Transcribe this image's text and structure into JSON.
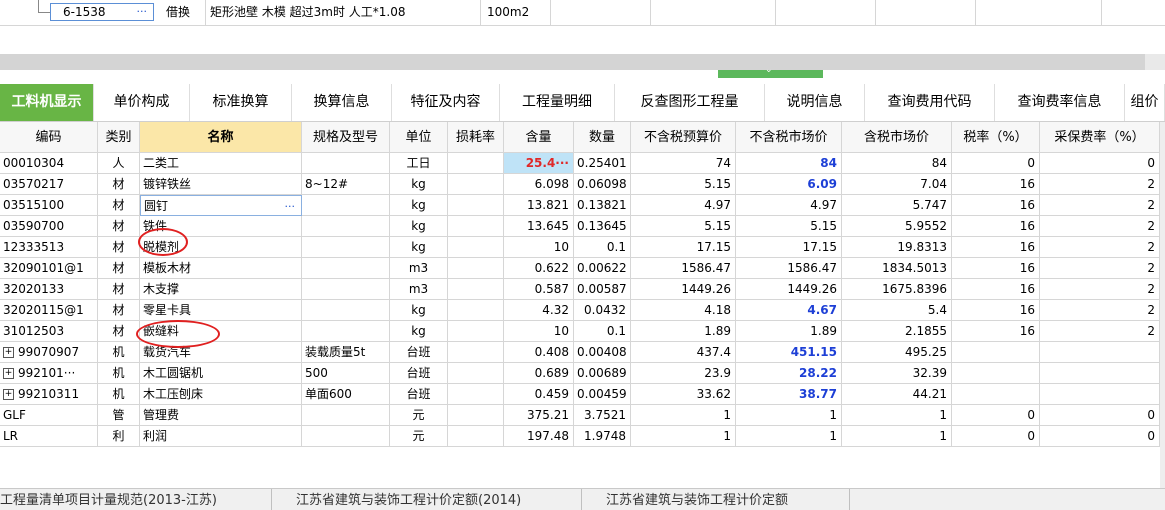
{
  "top_row": {
    "code": "6-1538",
    "type": "借换",
    "name": "矩形池壁 木模  超过3m时 人工*1.08",
    "unit": "100m2"
  },
  "tabs": [
    {
      "label": "工料机显示",
      "active": true
    },
    {
      "label": "单价构成"
    },
    {
      "label": "标准换算"
    },
    {
      "label": "换算信息"
    },
    {
      "label": "特征及内容"
    },
    {
      "label": "工程量明细"
    },
    {
      "label": "反查图形工程量"
    },
    {
      "label": "说明信息"
    },
    {
      "label": "查询费用代码"
    },
    {
      "label": "查询费率信息"
    },
    {
      "label": "组价"
    }
  ],
  "columns": [
    "编码",
    "类别",
    "名称",
    "规格及型号",
    "单位",
    "损耗率",
    "含量",
    "数量",
    "不含税预算价",
    "不含税市场价",
    "含税市场价",
    "税率（%）",
    "采保费率（%）"
  ],
  "rows": [
    {
      "code": "00010304",
      "cat": "人",
      "name": "二类工",
      "spec": "",
      "unit": "工日",
      "loss": "",
      "content": "25.4···",
      "qty": "0.25401",
      "budget": "74",
      "market": "84",
      "taxmarket": "84",
      "tax": "0",
      "fee": "0",
      "content_red": true,
      "market_blue": true
    },
    {
      "code": "03570217",
      "cat": "材",
      "name": "镀锌铁丝",
      "spec": "8~12#",
      "unit": "kg",
      "loss": "",
      "content": "6.098",
      "qty": "0.06098",
      "budget": "5.15",
      "market": "6.09",
      "taxmarket": "7.04",
      "tax": "16",
      "fee": "2",
      "market_blue": true
    },
    {
      "code": "03515100",
      "cat": "材",
      "name": "圆钉",
      "spec": "",
      "unit": "kg",
      "loss": "",
      "content": "13.821",
      "qty": "0.13821",
      "budget": "4.97",
      "market": "4.97",
      "taxmarket": "5.747",
      "tax": "16",
      "fee": "2",
      "editing": true
    },
    {
      "code": "03590700",
      "cat": "材",
      "name": "铁件",
      "spec": "",
      "unit": "kg",
      "loss": "",
      "content": "13.645",
      "qty": "0.13645",
      "budget": "5.15",
      "market": "5.15",
      "taxmarket": "5.9552",
      "tax": "16",
      "fee": "2"
    },
    {
      "code": "12333513",
      "cat": "材",
      "name": "脱模剂",
      "spec": "",
      "unit": "kg",
      "loss": "",
      "content": "10",
      "qty": "0.1",
      "budget": "17.15",
      "market": "17.15",
      "taxmarket": "19.8313",
      "tax": "16",
      "fee": "2"
    },
    {
      "code": "32090101@1",
      "cat": "材",
      "name": "模板木材",
      "spec": "",
      "unit": "m3",
      "loss": "",
      "content": "0.622",
      "qty": "0.00622",
      "budget": "1586.47",
      "market": "1586.47",
      "taxmarket": "1834.5013",
      "tax": "16",
      "fee": "2"
    },
    {
      "code": "32020133",
      "cat": "材",
      "name": "木支撑",
      "spec": "",
      "unit": "m3",
      "loss": "",
      "content": "0.587",
      "qty": "0.00587",
      "budget": "1449.26",
      "market": "1449.26",
      "taxmarket": "1675.8396",
      "tax": "16",
      "fee": "2"
    },
    {
      "code": "32020115@1",
      "cat": "材",
      "name": "零星卡具",
      "spec": "",
      "unit": "kg",
      "loss": "",
      "content": "4.32",
      "qty": "0.0432",
      "budget": "4.18",
      "market": "4.67",
      "taxmarket": "5.4",
      "tax": "16",
      "fee": "2",
      "market_blue": true
    },
    {
      "code": "31012503",
      "cat": "材",
      "name": "嵌缝料",
      "spec": "",
      "unit": "kg",
      "loss": "",
      "content": "10",
      "qty": "0.1",
      "budget": "1.89",
      "market": "1.89",
      "taxmarket": "2.1855",
      "tax": "16",
      "fee": "2"
    },
    {
      "code": "99070907",
      "cat": "机",
      "name": "载货汽车",
      "spec": "装载质量5t",
      "unit": "台班",
      "loss": "",
      "content": "0.408",
      "qty": "0.00408",
      "budget": "437.4",
      "market": "451.15",
      "taxmarket": "495.25",
      "tax": "",
      "fee": "",
      "market_blue": true,
      "expand": "+"
    },
    {
      "code": "992101···",
      "cat": "机",
      "name": "木工圆锯机",
      "spec": "500",
      "unit": "台班",
      "loss": "",
      "content": "0.689",
      "qty": "0.00689",
      "budget": "23.9",
      "market": "28.22",
      "taxmarket": "32.39",
      "tax": "",
      "fee": "",
      "market_blue": true,
      "expand": "+"
    },
    {
      "code": "99210311",
      "cat": "机",
      "name": "木工压刨床",
      "spec": "单面600",
      "unit": "台班",
      "loss": "",
      "content": "0.459",
      "qty": "0.00459",
      "budget": "33.62",
      "market": "38.77",
      "taxmarket": "44.21",
      "tax": "",
      "fee": "",
      "market_blue": true,
      "expand": "+"
    },
    {
      "code": "GLF",
      "cat": "管",
      "name": "管理费",
      "spec": "",
      "unit": "元",
      "loss": "",
      "content": "375.21",
      "qty": "3.7521",
      "budget": "1",
      "market": "1",
      "taxmarket": "1",
      "tax": "0",
      "fee": "0"
    },
    {
      "code": "LR",
      "cat": "利",
      "name": "利润",
      "spec": "",
      "unit": "元",
      "loss": "",
      "content": "197.48",
      "qty": "1.9748",
      "budget": "1",
      "market": "1",
      "taxmarket": "1",
      "tax": "0",
      "fee": "0"
    }
  ],
  "bottom_tabs": [
    "工程量清单项目计量规范(2013-江苏)",
    "江苏省建筑与装饰工程计价定额(2014)",
    "江苏省建筑与装饰工程计价定额"
  ],
  "colors": {
    "accent": "#68b545",
    "blue": "#1d3fd6",
    "red": "#e02828",
    "annotation": "#e02020"
  },
  "icons": {
    "splitter": "chevron-down-icon",
    "expand": "plus-square-icon",
    "ellipsis": "ellipsis-icon"
  }
}
